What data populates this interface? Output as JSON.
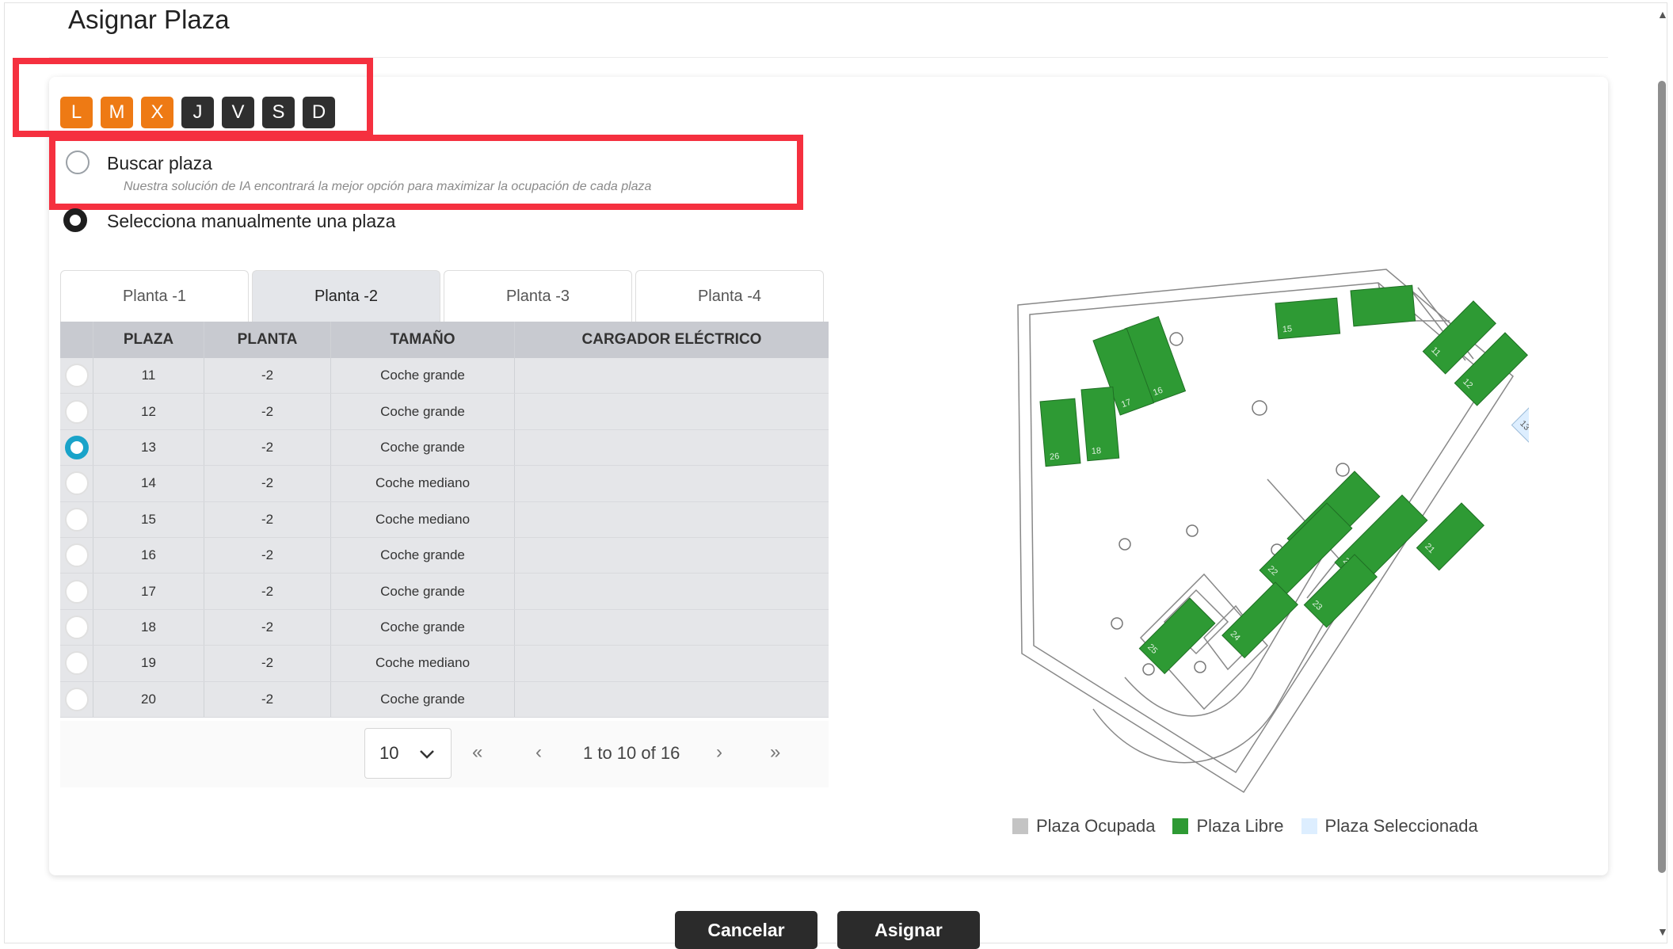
{
  "dialog": {
    "title": "Asignar Plaza"
  },
  "days": [
    {
      "label": "L",
      "active": true
    },
    {
      "label": "M",
      "active": true
    },
    {
      "label": "X",
      "active": true
    },
    {
      "label": "J",
      "active": false
    },
    {
      "label": "V",
      "active": false
    },
    {
      "label": "S",
      "active": false
    },
    {
      "label": "D",
      "active": false
    }
  ],
  "modes": {
    "auto": {
      "label": "Buscar plaza",
      "hint": "Nuestra solución de IA encontrará la mejor opción para maximizar la ocupación de cada plaza",
      "selected": false
    },
    "manual": {
      "label": "Selecciona manualmente una plaza",
      "selected": true
    }
  },
  "tabs": [
    {
      "label": "Planta -1",
      "active": false
    },
    {
      "label": "Planta -2",
      "active": true
    },
    {
      "label": "Planta -3",
      "active": false
    },
    {
      "label": "Planta -4",
      "active": false
    }
  ],
  "table": {
    "columns": [
      "PLAZA",
      "PLANTA",
      "TAMAÑO",
      "CARGADOR ELÉCTRICO"
    ],
    "rows": [
      {
        "plaza": "11",
        "planta": "-2",
        "tamano": "Coche grande",
        "cargador": "",
        "selected": false
      },
      {
        "plaza": "12",
        "planta": "-2",
        "tamano": "Coche grande",
        "cargador": "",
        "selected": false
      },
      {
        "plaza": "13",
        "planta": "-2",
        "tamano": "Coche grande",
        "cargador": "",
        "selected": true
      },
      {
        "plaza": "14",
        "planta": "-2",
        "tamano": "Coche mediano",
        "cargador": "",
        "selected": false
      },
      {
        "plaza": "15",
        "planta": "-2",
        "tamano": "Coche mediano",
        "cargador": "",
        "selected": false
      },
      {
        "plaza": "16",
        "planta": "-2",
        "tamano": "Coche grande",
        "cargador": "",
        "selected": false
      },
      {
        "plaza": "17",
        "planta": "-2",
        "tamano": "Coche grande",
        "cargador": "",
        "selected": false
      },
      {
        "plaza": "18",
        "planta": "-2",
        "tamano": "Coche grande",
        "cargador": "",
        "selected": false
      },
      {
        "plaza": "19",
        "planta": "-2",
        "tamano": "Coche mediano",
        "cargador": "",
        "selected": false
      },
      {
        "plaza": "20",
        "planta": "-2",
        "tamano": "Coche grande",
        "cargador": "",
        "selected": false
      }
    ]
  },
  "pagination": {
    "page_size": "10",
    "info": "1 to 10 of 16",
    "first": "«",
    "prev": "‹",
    "next": "›",
    "last": "»"
  },
  "map": {
    "spots": [
      "11",
      "12",
      "13",
      "15",
      "16",
      "17",
      "18",
      "19",
      "20",
      "21",
      "22",
      "23",
      "24",
      "25",
      "26"
    ],
    "selected_spot": "13"
  },
  "legend": {
    "occupied": {
      "label": "Plaza Ocupada",
      "color": "#c4c4c4"
    },
    "free": {
      "label": "Plaza Libre",
      "color": "#2e9a34"
    },
    "selected": {
      "label": "Plaza Seleccionada",
      "color": "#ddeeff"
    }
  },
  "buttons": {
    "cancel": "Cancelar",
    "assign": "Asignar"
  },
  "colors": {
    "accent_orange": "#ee7a14",
    "dark": "#2f2f2f",
    "annotation_red": "#f5303f",
    "selection_blue": "#19a3c9"
  }
}
